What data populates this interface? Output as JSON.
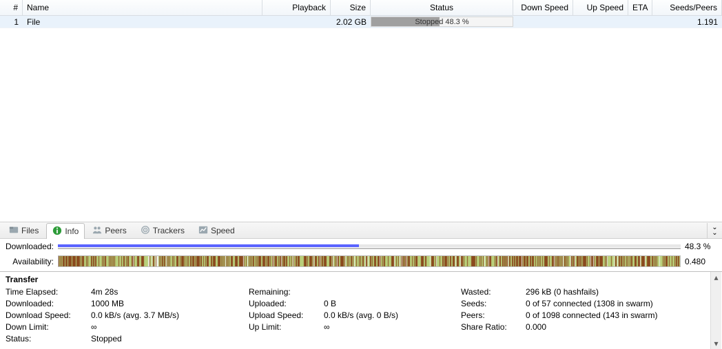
{
  "list": {
    "headers": {
      "num": "#",
      "name": "Name",
      "playback": "Playback",
      "size": "Size",
      "status": "Status",
      "down": "Down Speed",
      "up": "Up Speed",
      "eta": "ETA",
      "seeds": "Seeds/Peers"
    },
    "row": {
      "num": "1",
      "name": "File",
      "playback": "",
      "size": "2.02 GB",
      "status_text": "Stopped 48.3 %",
      "status_percent": 48.3,
      "down": "",
      "up": "",
      "eta": "",
      "seeds": "1.191"
    }
  },
  "tabs": [
    {
      "id": "files",
      "label": "Files"
    },
    {
      "id": "info",
      "label": "Info"
    },
    {
      "id": "peers",
      "label": "Peers"
    },
    {
      "id": "trackers",
      "label": "Trackers"
    },
    {
      "id": "speed",
      "label": "Speed"
    }
  ],
  "active_tab": "info",
  "stripes": {
    "downloaded_label": "Downloaded:",
    "downloaded_value": "48.3 %",
    "downloaded_percent": 48.3,
    "availability_label": "Availability:",
    "availability_value": "0.480"
  },
  "transfer": {
    "title": "Transfer",
    "time_elapsed_label": "Time Elapsed:",
    "time_elapsed": "4m 28s",
    "remaining_label": "Remaining:",
    "remaining": "",
    "wasted_label": "Wasted:",
    "wasted": "296 kB (0 hashfails)",
    "downloaded_label": "Downloaded:",
    "downloaded": "1000 MB",
    "uploaded_label": "Uploaded:",
    "uploaded": "0 B",
    "seeds_label": "Seeds:",
    "seeds": "0 of 57 connected (1308 in swarm)",
    "dlspeed_label": "Download Speed:",
    "dlspeed": "0.0 kB/s (avg. 3.7 MB/s)",
    "ulspeed_label": "Upload Speed:",
    "ulspeed": "0.0 kB/s (avg. 0 B/s)",
    "peers_label": "Peers:",
    "peers": "0 of 1098 connected (143 in swarm)",
    "downlimit_label": "Down Limit:",
    "downlimit": "∞",
    "uplimit_label": "Up Limit:",
    "uplimit": "∞",
    "share_label": "Share Ratio:",
    "share": "0.000",
    "status_label": "Status:",
    "status": "Stopped"
  }
}
